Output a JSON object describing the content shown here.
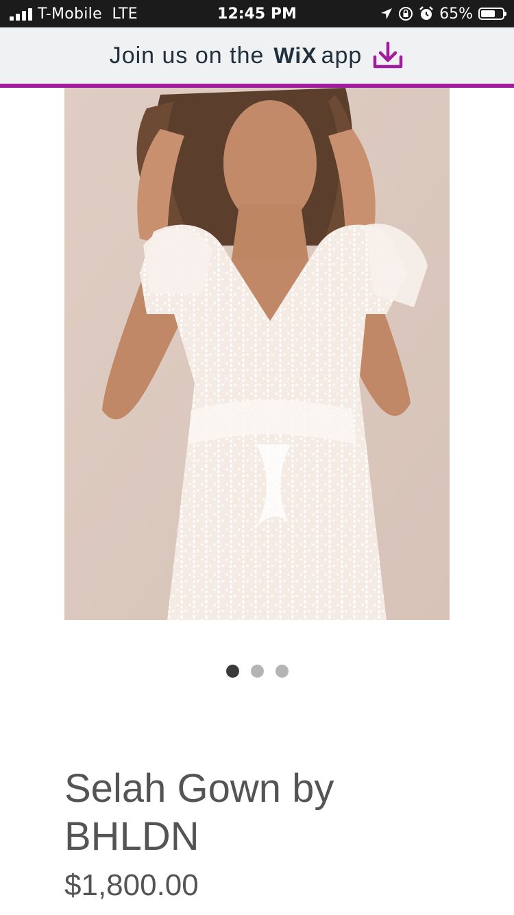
{
  "status_bar": {
    "carrier": "T-Mobile  LTE",
    "time": "12:45 PM",
    "battery_percent": "65%",
    "battery_level": 0.65
  },
  "banner": {
    "prefix": "Join us on the",
    "logo": "WiX",
    "suffix": "app",
    "accent_color": "#a21c9e"
  },
  "gallery": {
    "slide_count": 3,
    "active_index": 0,
    "image_description": "Model wearing white lace cap-sleeve gown"
  },
  "product": {
    "title": "Selah Gown by BHLDN",
    "price": "$1,800.00"
  }
}
